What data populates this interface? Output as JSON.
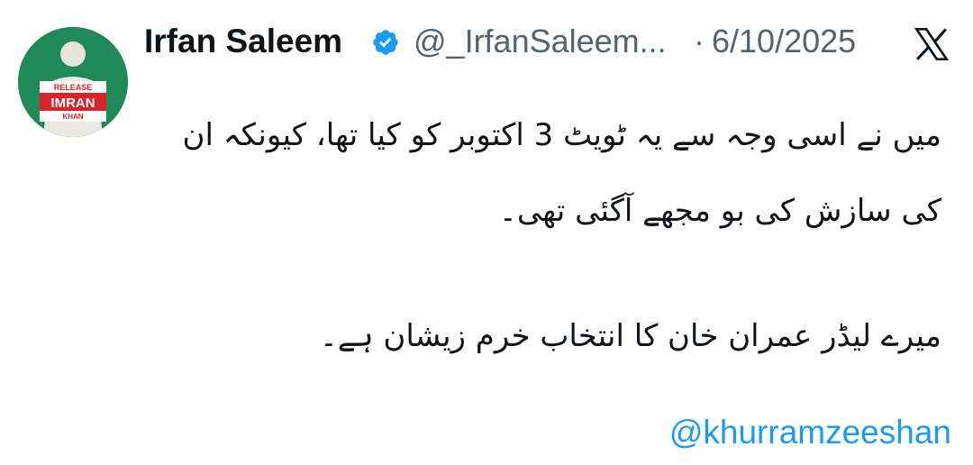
{
  "tweet": {
    "author_name": "Irfan Saleem",
    "handle": "@_IrfanSaleem...",
    "separator": "·",
    "date": "6/10/2025",
    "avatar": {
      "badge_top": "RELEASE",
      "badge_main": "IMRAN",
      "badge_bottom": "KHAN"
    },
    "body": {
      "paragraph_1": "میں نے اسی وجہ سے یہ ٹویٹ 3 اکتوبر کو کیا تھا، کیونکہ ان کی سازش کی بو مجھے آگئی تھی۔",
      "paragraph_2": "میرے لیڈر عمران خان کا انتخاب خرم زیشان ہے۔"
    },
    "mention": "@khurramzeeshan"
  },
  "colors": {
    "text": "#0f1419",
    "secondary_text": "#536471",
    "link": "#1d9bf0",
    "verified_badge": "#1d9bf0",
    "avatar_background": "#1f8a57",
    "badge_red": "#d8232a"
  },
  "icons": {
    "verified": "verified-badge-icon",
    "platform": "x-logo-icon"
  }
}
